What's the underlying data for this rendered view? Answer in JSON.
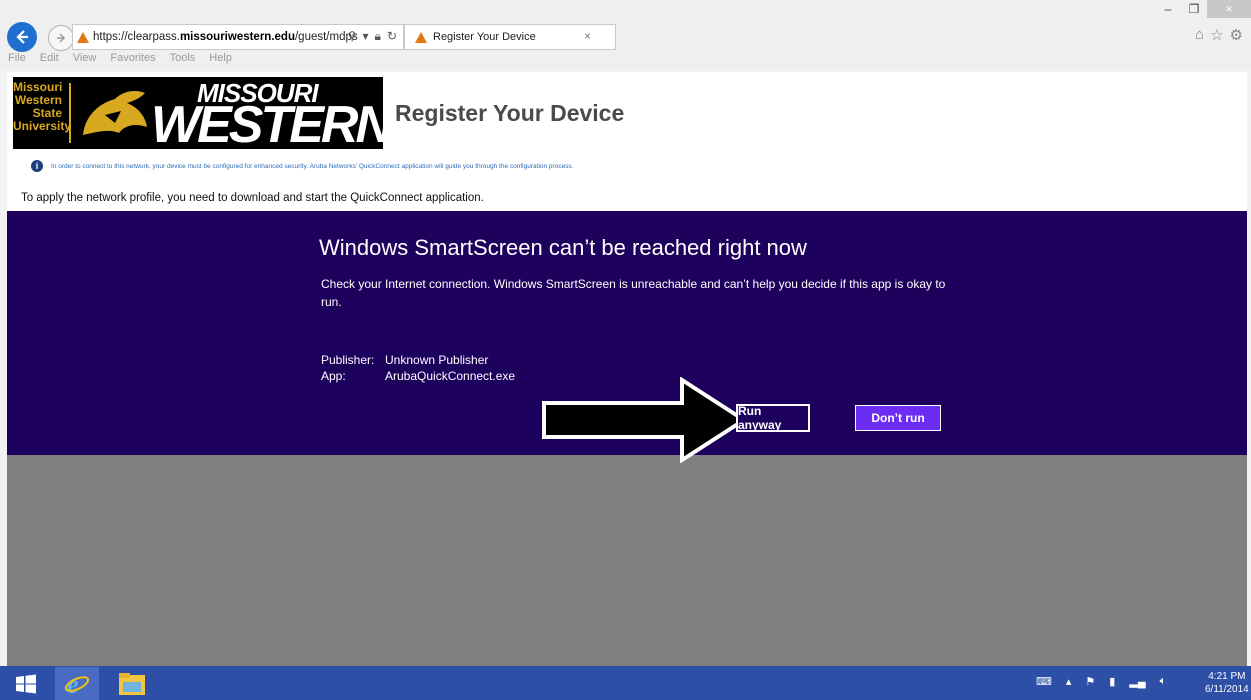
{
  "browser": {
    "url_prefix": "https://clearpass.",
    "url_domain": "missouriwestern.edu",
    "url_path": "/guest/mdps",
    "tab_title": "Register Your Device",
    "menu": [
      "File",
      "Edit",
      "View",
      "Favorites",
      "Tools",
      "Help"
    ]
  },
  "page": {
    "logo_text_left": [
      "Missouri",
      "Western",
      "State",
      "University"
    ],
    "logo_word1": "MISSOURI",
    "logo_word2": "WESTERN",
    "title": "Register Your Device",
    "info": "In order to connect to this network, your device must be configured for enhanced security. Aruba Networks' QuickConnect application will guide you through the configuration process.",
    "apply": "To apply the network profile, you need to download and start the QuickConnect application."
  },
  "smartscreen": {
    "title": "Windows SmartScreen can’t be reached right now",
    "body": "Check your Internet connection. Windows SmartScreen is unreachable and can’t help you decide if this app is okay to run.",
    "publisher_label": "Publisher:",
    "publisher_value": "Unknown Publisher",
    "app_label": "App:",
    "app_value": "ArubaQuickConnect.exe",
    "run_label": "Run anyway",
    "dont_label": "Don’t run"
  },
  "taskbar": {
    "time": "4:21 PM",
    "date": "6/11/2014"
  },
  "colors": {
    "smartscreen_bg": "#1e005d",
    "dont_run_bg": "#6c2cf2",
    "taskbar": "#2d4fa6",
    "info_text": "#2f6cb7"
  }
}
